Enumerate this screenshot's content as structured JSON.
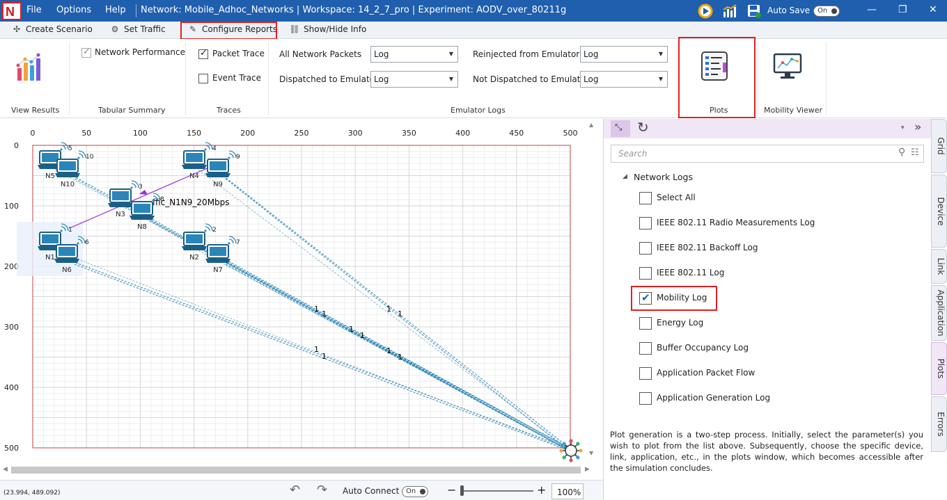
{
  "titlebar": {
    "menu": [
      "File",
      "Options",
      "Help"
    ],
    "title": "Network: Mobile_Adhoc_Networks | Workspace: 14_2_7_pro | Experiment: AODV_over_80211g",
    "autosave_label": "Auto Save",
    "autosave_state": "On"
  },
  "toolbar": {
    "create_scenario": "Create Scenario",
    "set_traffic": "Set Traffic",
    "configure_reports": "Configure Reports",
    "show_hide_info": "Show/Hide Info"
  },
  "ribbon": {
    "view_results": "View Results",
    "network_performance": "Network Performance",
    "tabular_summary": "Tabular Summary",
    "packet_trace": "Packet Trace",
    "event_trace": "Event Trace",
    "traces": "Traces",
    "all_network_packets": "All Network Packets",
    "dispatched_to_emulator": "Dispatched to Emulator",
    "reinjected_from_emulator": "Reinjected from Emulator",
    "not_dispatched_to_emulator": "Not Dispatched to Emulator",
    "log_value": "Log",
    "emulator_logs": "Emulator Logs",
    "plots": "Plots",
    "mobility_viewer": "Mobility Viewer"
  },
  "grid": {
    "x_ticks": [
      "0",
      "50",
      "100",
      "150",
      "200",
      "250",
      "300",
      "350",
      "400",
      "450",
      "500"
    ],
    "y_ticks": [
      "0",
      "100",
      "200",
      "300",
      "400",
      "500"
    ]
  },
  "nodes": [
    {
      "name": "N5",
      "id": "5"
    },
    {
      "name": "N10",
      "id": "10"
    },
    {
      "name": "N4",
      "id": "4"
    },
    {
      "name": "N9",
      "id": "9"
    },
    {
      "name": "N3",
      "id": "3"
    },
    {
      "name": "N8",
      "id": "8"
    },
    {
      "name": "N1",
      "id": "1"
    },
    {
      "name": "N6",
      "id": "6"
    },
    {
      "name": "N2",
      "id": "2"
    },
    {
      "name": "N7",
      "id": "7"
    }
  ],
  "traffic_label": "ffic_N1N9_20Mbps",
  "link_label": "1",
  "statusbar": {
    "coords": "(23.994, 489.092)",
    "auto_connect": "Auto Connect",
    "auto_connect_state": "On",
    "zoom": "100%"
  },
  "panel": {
    "search_placeholder": "Search",
    "tree_root": "Network Logs",
    "items": [
      {
        "label": "Select All",
        "checked": false
      },
      {
        "label": "IEEE 802.11 Radio Measurements Log",
        "checked": false
      },
      {
        "label": "IEEE 802.11 Backoff Log",
        "checked": false
      },
      {
        "label": "IEEE 802.11 Log",
        "checked": false
      },
      {
        "label": "Mobility Log",
        "checked": true
      },
      {
        "label": "Energy Log",
        "checked": false
      },
      {
        "label": "Buffer Occupancy Log",
        "checked": false
      },
      {
        "label": "Application Packet Flow",
        "checked": false
      },
      {
        "label": "Application Generation Log",
        "checked": false
      }
    ],
    "description": "Plot generation is a two-step process. Initially, select the parameter(s) you wish to plot from the list above. Subsequently, choose the specific device, link, application, etc., in the plots window, which becomes accessible after the simulation concludes."
  },
  "side_tabs": [
    "Grid",
    "Device",
    "Link",
    "Application",
    "Plots",
    "Errors"
  ]
}
